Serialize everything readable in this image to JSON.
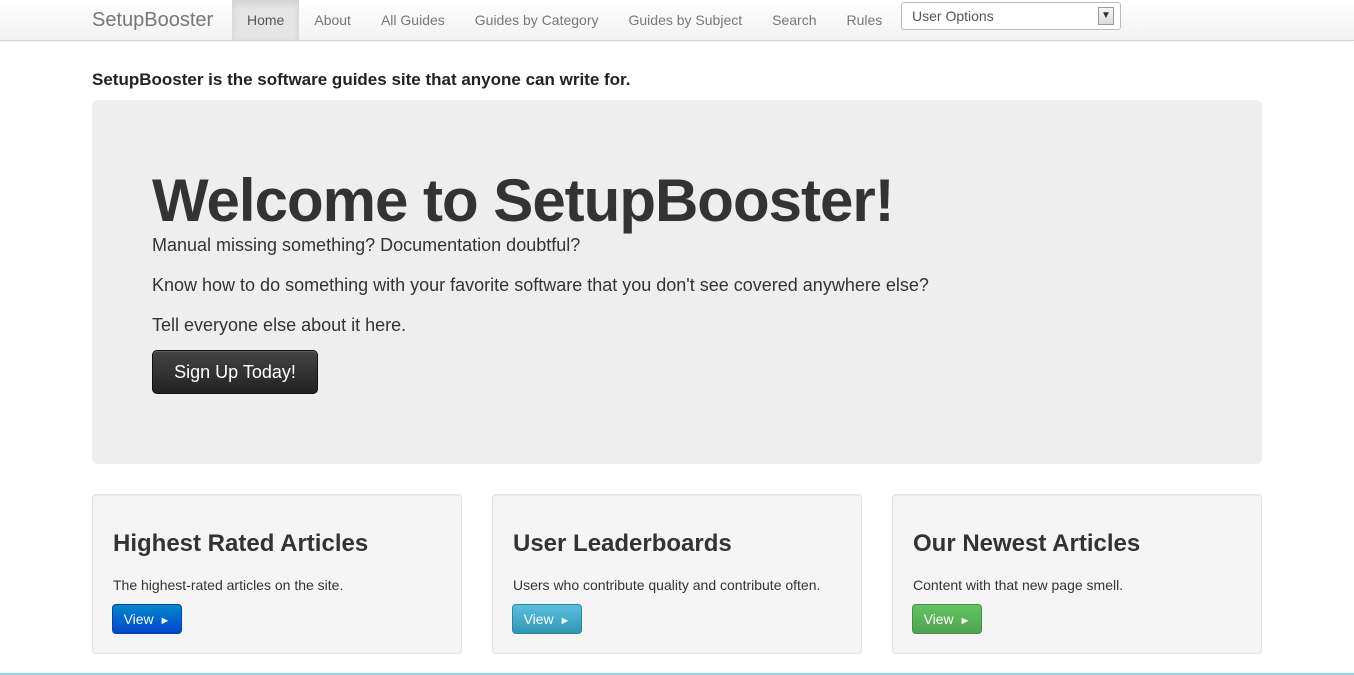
{
  "navbar": {
    "brand": "SetupBooster",
    "items": [
      {
        "label": "Home",
        "active": true
      },
      {
        "label": "About",
        "active": false
      },
      {
        "label": "All Guides",
        "active": false
      },
      {
        "label": "Guides by Category",
        "active": false
      },
      {
        "label": "Guides by Subject",
        "active": false
      },
      {
        "label": "Search",
        "active": false
      },
      {
        "label": "Rules",
        "active": false
      }
    ],
    "user_options": {
      "selected": "User Options",
      "arrow_icon": "chevron-down-icon"
    }
  },
  "tagline": "SetupBooster is the software guides site that anyone can write for.",
  "hero": {
    "title": "Welcome to SetupBooster!",
    "lines": [
      "Manual missing something? Documentation doubtful?",
      "Know how to do something with your favorite software that you don't see covered anywhere else?",
      "Tell everyone else about it here."
    ],
    "signup_label": "Sign Up Today!"
  },
  "cards": [
    {
      "title": "Highest Rated Articles",
      "description": "The highest-rated articles on the site.",
      "button_label": "View",
      "button_arrow": "►",
      "button_color": "#0055cc"
    },
    {
      "title": "User Leaderboards",
      "description": "Users who contribute quality and contribute often.",
      "button_label": "View",
      "button_arrow": "►",
      "button_color": "#46a9c8"
    },
    {
      "title": "Our Newest Articles",
      "description": "Content with that new page smell.",
      "button_label": "View",
      "button_arrow": "►",
      "button_color": "#57ab57"
    }
  ],
  "colors": {
    "hero_background": "#eeeeee",
    "card_background": "#f5f5f5",
    "navbar_background": "#f7f7f7"
  }
}
